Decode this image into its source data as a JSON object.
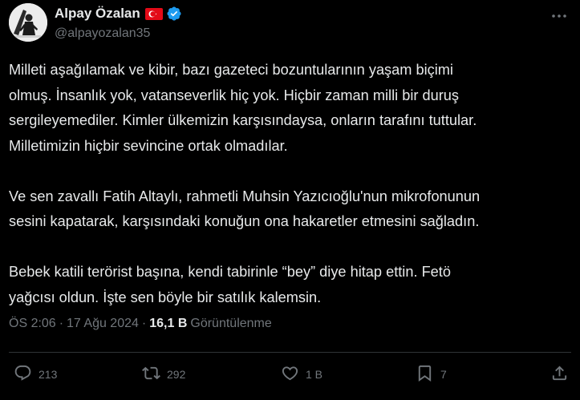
{
  "author": {
    "display_name": "Alpay Özalan",
    "handle": "@alpayozalan35",
    "flag": "turkey-flag-icon",
    "verified": "verified-badge-icon"
  },
  "tweet": {
    "paragraphs": [
      [
        "Milleti aşağılamak ve kibir, bazı gazeteci bozuntularının yaşam biçimi",
        "olmuş. İnsanlık yok, vatanseverlik hiç yok. Hiçbir zaman milli bir duruş",
        "sergileyemediler. Kimler ülkemizin karşısındaysa, onların tarafını tuttular.",
        "Milletimizin hiçbir sevincine ortak olmadılar."
      ],
      [
        "Ve sen zavallı Fatih Altaylı, rahmetli Muhsin Yazıcıoğlu'nun mikrofonunun",
        "sesini kapatarak, karşısındaki konuğun ona hakaretler etmesini sağladın."
      ],
      [
        "Bebek katili terörist başına, kendi tabirinle “bey” diye hitap ettin. Fetö",
        "yağcısı oldun. İşte sen böyle bir satılık kalemsin."
      ]
    ]
  },
  "meta": {
    "time": "ÖS 2:06",
    "separator": "·",
    "date": "17 Ağu 2024",
    "separator2": "·",
    "views_count": "16,1 B",
    "views_label": "Görüntülenme"
  },
  "actions": {
    "reply": {
      "icon": "reply-icon",
      "count": "213"
    },
    "repost": {
      "icon": "repost-icon",
      "count": "292"
    },
    "like": {
      "icon": "heart-icon",
      "count": "1 B"
    },
    "bookmark": {
      "icon": "bookmark-icon",
      "count": "7"
    },
    "share": {
      "icon": "share-icon"
    }
  },
  "colors": {
    "background": "#000000",
    "text": "#e7e9ea",
    "secondary": "#71767b",
    "verified": "#1d9bf0",
    "flag_red": "#e30a17"
  }
}
